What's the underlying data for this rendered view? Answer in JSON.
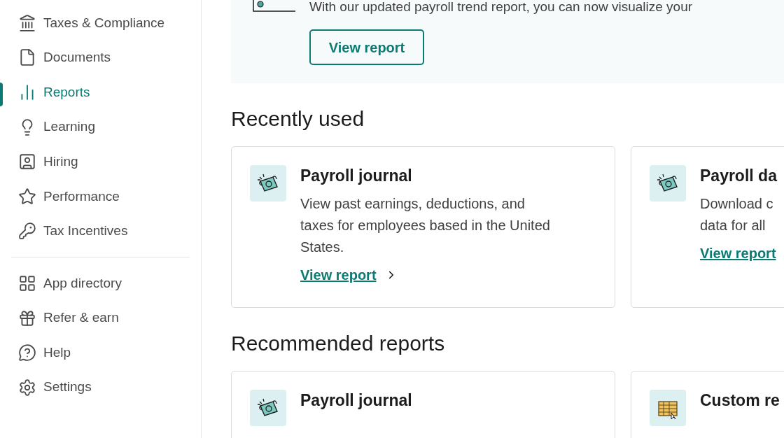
{
  "sidebar": {
    "items": [
      {
        "label": "Taxes & Compliance",
        "selected": false
      },
      {
        "label": "Documents",
        "selected": false
      },
      {
        "label": "Reports",
        "selected": true
      },
      {
        "label": "Learning",
        "selected": false
      },
      {
        "label": "Hiring",
        "selected": false
      },
      {
        "label": "Performance",
        "selected": false
      },
      {
        "label": "Tax Incentives",
        "selected": false
      }
    ],
    "secondary_items": [
      {
        "label": "App directory"
      },
      {
        "label": "Refer & earn"
      },
      {
        "label": "Help"
      },
      {
        "label": "Settings"
      }
    ]
  },
  "banner": {
    "text": "With our updated payroll trend report, you can now visualize your",
    "button": "View report"
  },
  "sections": [
    {
      "title": "Recently used",
      "cards": [
        {
          "title": "Payroll journal",
          "description_lines": [
            "View past earnings, deductions, and",
            "taxes for employees based in the United",
            "States."
          ],
          "link": "View report"
        },
        {
          "title": "Payroll da",
          "description_lines": [
            "Download c",
            "data for all"
          ],
          "link": "View report"
        }
      ]
    },
    {
      "title": "Recommended reports",
      "cards": [
        {
          "title": "Payroll journal"
        },
        {
          "title": "Custom re"
        }
      ]
    }
  ]
}
